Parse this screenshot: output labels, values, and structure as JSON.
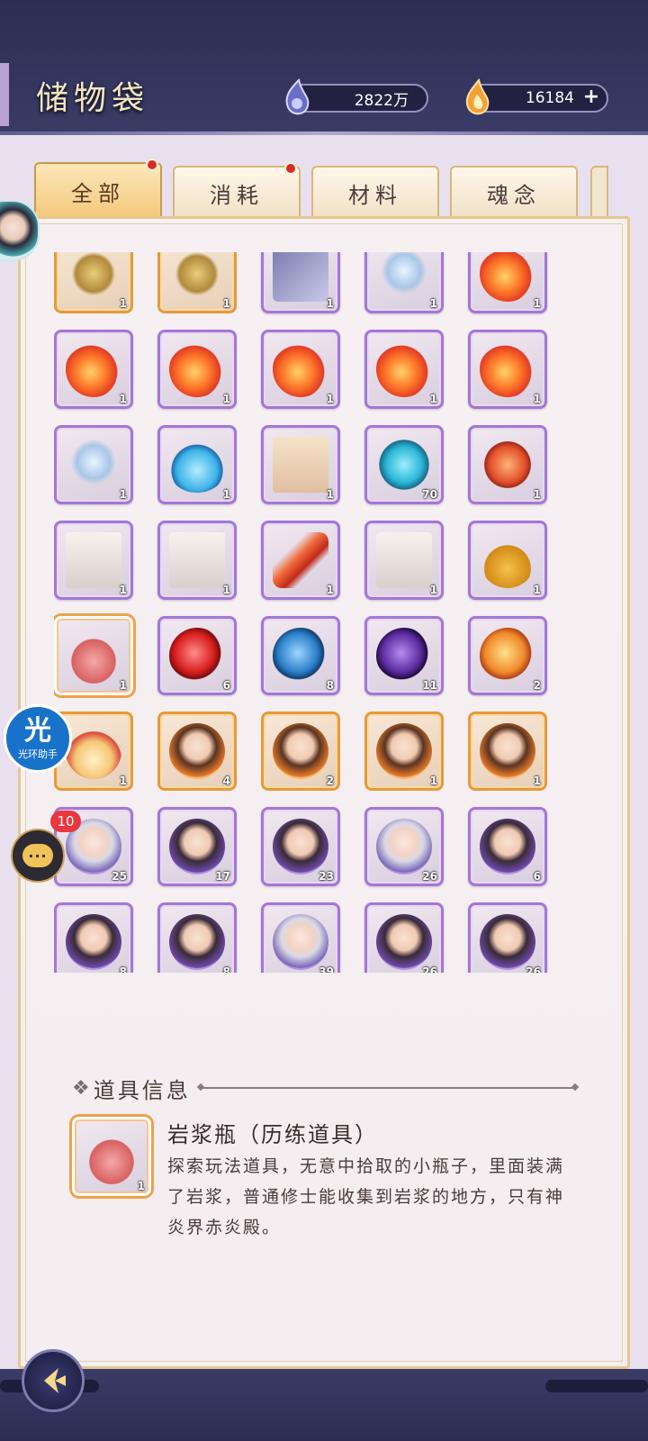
{
  "header": {
    "title": "储物袋",
    "currency_spirit": "2822万",
    "currency_fire": "16184",
    "plus_label": "+"
  },
  "tabs": [
    {
      "label": "全部",
      "active": true,
      "badge": true
    },
    {
      "label": "消耗",
      "active": false,
      "badge": true
    },
    {
      "label": "材料",
      "active": false,
      "badge": false
    },
    {
      "label": "魂念",
      "active": false,
      "badge": false
    }
  ],
  "items": [
    {
      "icon": "bell",
      "count": "1",
      "frame": "gold"
    },
    {
      "icon": "bell",
      "count": "1",
      "frame": "gold"
    },
    {
      "icon": "card",
      "count": "1",
      "frame": "purple"
    },
    {
      "icon": "ribbon",
      "count": "1",
      "frame": "purple"
    },
    {
      "icon": "flame",
      "count": "1",
      "frame": "purple"
    },
    {
      "icon": "flame",
      "count": "1",
      "frame": "purple"
    },
    {
      "icon": "flame",
      "count": "1",
      "frame": "purple"
    },
    {
      "icon": "flame",
      "count": "1",
      "frame": "purple"
    },
    {
      "icon": "flame",
      "count": "1",
      "frame": "purple"
    },
    {
      "icon": "flame",
      "count": "1",
      "frame": "purple"
    },
    {
      "icon": "ribbon",
      "count": "1",
      "frame": "purple"
    },
    {
      "icon": "drop",
      "count": "1",
      "frame": "purple"
    },
    {
      "icon": "scroll",
      "count": "1",
      "frame": "purple"
    },
    {
      "icon": "blue",
      "count": "70",
      "frame": "purple"
    },
    {
      "icon": "seal",
      "count": "1",
      "frame": "purple"
    },
    {
      "icon": "paper",
      "count": "1",
      "frame": "purple"
    },
    {
      "icon": "paper",
      "count": "1",
      "frame": "purple"
    },
    {
      "icon": "feather",
      "count": "1",
      "frame": "purple"
    },
    {
      "icon": "paper",
      "count": "1",
      "frame": "purple"
    },
    {
      "icon": "gourd",
      "count": "1",
      "frame": "purple"
    },
    {
      "icon": "potion",
      "count": "1",
      "frame": "selected"
    },
    {
      "icon": "red",
      "count": "6",
      "frame": "purple"
    },
    {
      "icon": "cyan",
      "count": "8",
      "frame": "purple"
    },
    {
      "icon": "purple",
      "count": "11",
      "frame": "purple"
    },
    {
      "icon": "orange",
      "count": "2",
      "frame": "purple"
    },
    {
      "icon": "lotus",
      "count": "1",
      "frame": "gold"
    },
    {
      "icon": "face warm",
      "count": "4",
      "frame": "gold"
    },
    {
      "icon": "face warm",
      "count": "2",
      "frame": "gold"
    },
    {
      "icon": "face warm",
      "count": "1",
      "frame": "gold"
    },
    {
      "icon": "face warm",
      "count": "1",
      "frame": "gold"
    },
    {
      "icon": "face light",
      "count": "25",
      "frame": "purple"
    },
    {
      "icon": "face",
      "count": "17",
      "frame": "purple"
    },
    {
      "icon": "face",
      "count": "23",
      "frame": "purple"
    },
    {
      "icon": "face light",
      "count": "26",
      "frame": "purple"
    },
    {
      "icon": "face",
      "count": "6",
      "frame": "purple"
    },
    {
      "icon": "face",
      "count": "8",
      "frame": "purple"
    },
    {
      "icon": "face",
      "count": "8",
      "frame": "purple"
    },
    {
      "icon": "face light",
      "count": "39",
      "frame": "purple"
    },
    {
      "icon": "face",
      "count": "26",
      "frame": "purple"
    },
    {
      "icon": "face",
      "count": "26",
      "frame": "purple"
    }
  ],
  "info": {
    "section_title": "道具信息",
    "item_name": "岩浆瓶（历练道具）",
    "item_count": "1",
    "description": "探索玩法道具，无意中拾取的小瓶子，里面装满了岩浆，普通修士能收集到岩浆的地方，只有神炎界赤炎殿。"
  },
  "side": {
    "helper_big": "光",
    "helper_small": "光环助手",
    "chat_badge": "10",
    "chat_icon": "···"
  },
  "colors": {
    "header_bg": "#2b2d55",
    "accent_purple": "#a377d6",
    "accent_gold": "#e59a3a",
    "badge_red": "#d62a2a"
  }
}
